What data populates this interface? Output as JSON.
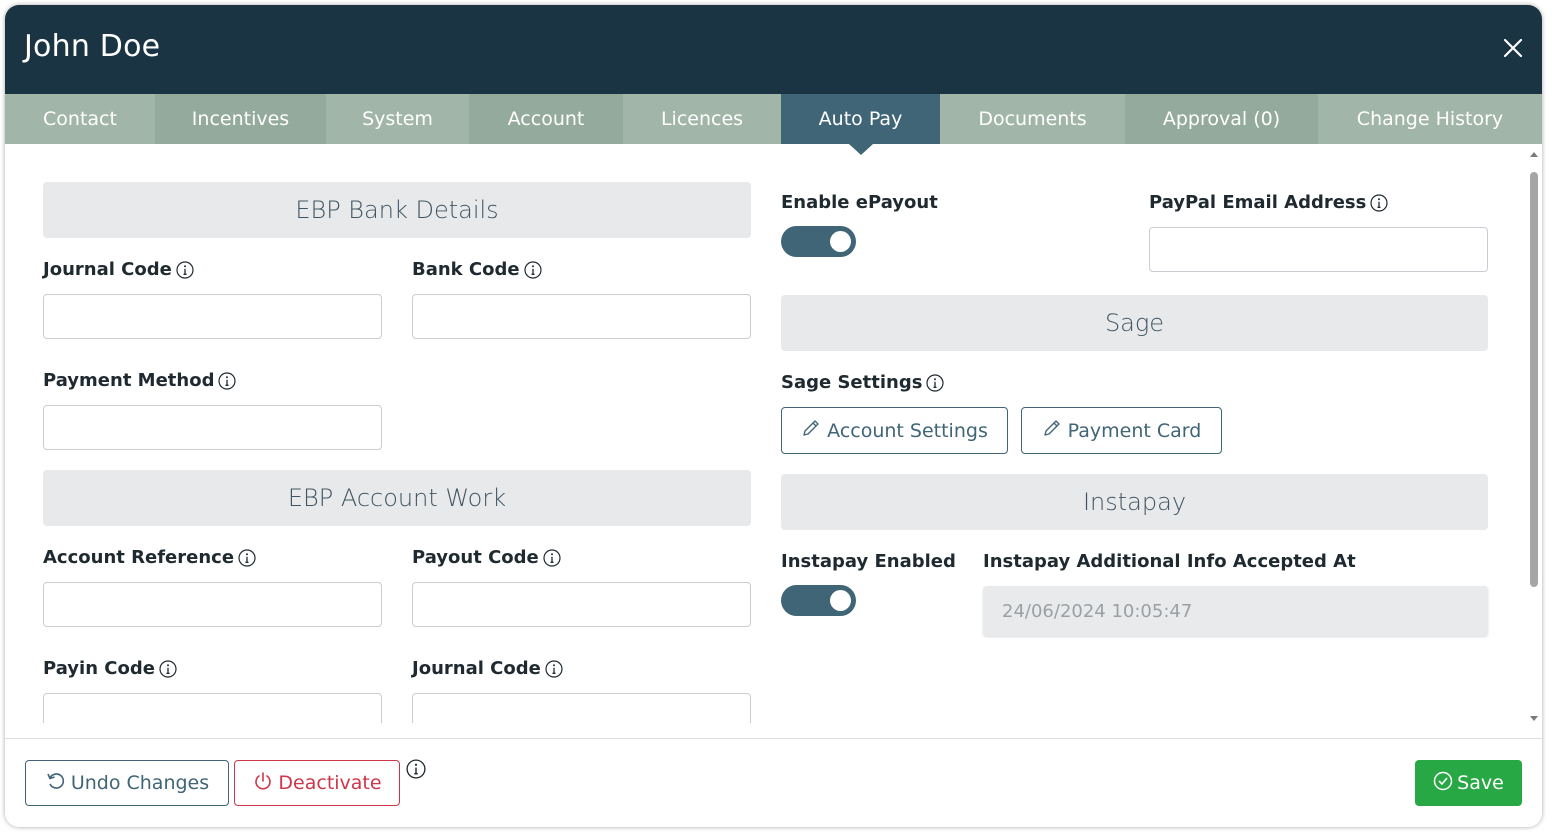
{
  "header": {
    "title": "John Doe"
  },
  "tabs": [
    {
      "label": "Contact"
    },
    {
      "label": "Incentives"
    },
    {
      "label": "System"
    },
    {
      "label": "Account"
    },
    {
      "label": "Licences"
    },
    {
      "label": "Auto Pay"
    },
    {
      "label": "Documents"
    },
    {
      "label": "Approval (0)"
    },
    {
      "label": "Change History"
    }
  ],
  "active_tab": "Auto Pay",
  "left": {
    "ebp_bank": {
      "heading": "EBP Bank Details",
      "journal_code_label": "Journal Code",
      "bank_code_label": "Bank Code",
      "payment_method_label": "Payment Method"
    },
    "ebp_account": {
      "heading": "EBP Account Work",
      "account_reference_label": "Account Reference",
      "payout_code_label": "Payout Code",
      "payin_code_label": "Payin Code",
      "journal_code_label": "Journal Code"
    }
  },
  "right": {
    "enable_epayout_label": "Enable ePayout",
    "enable_epayout_on": true,
    "paypal_email_label": "PayPal Email Address",
    "sage": {
      "heading": "Sage",
      "settings_label": "Sage Settings",
      "account_settings_button": "Account Settings",
      "payment_card_button": "Payment Card"
    },
    "instapay": {
      "heading": "Instapay",
      "enabled_label": "Instapay Enabled",
      "enabled_on": true,
      "accepted_at_label": "Instapay Additional Info Accepted At",
      "accepted_at_value": "24/06/2024 10:05:47"
    }
  },
  "footer": {
    "undo_label": "Undo Changes",
    "deactivate_label": "Deactivate",
    "save_label": "Save"
  },
  "colors": {
    "header_bg": "#1b3443",
    "tab_bg": "#a1b5a9",
    "tab_active_bg": "#406576",
    "save_green": "#28a745",
    "deactivate_red": "#d0364a"
  },
  "icons": [
    "close-icon",
    "info-icon",
    "pencil-icon",
    "undo-icon",
    "power-icon",
    "check-circle-icon"
  ]
}
